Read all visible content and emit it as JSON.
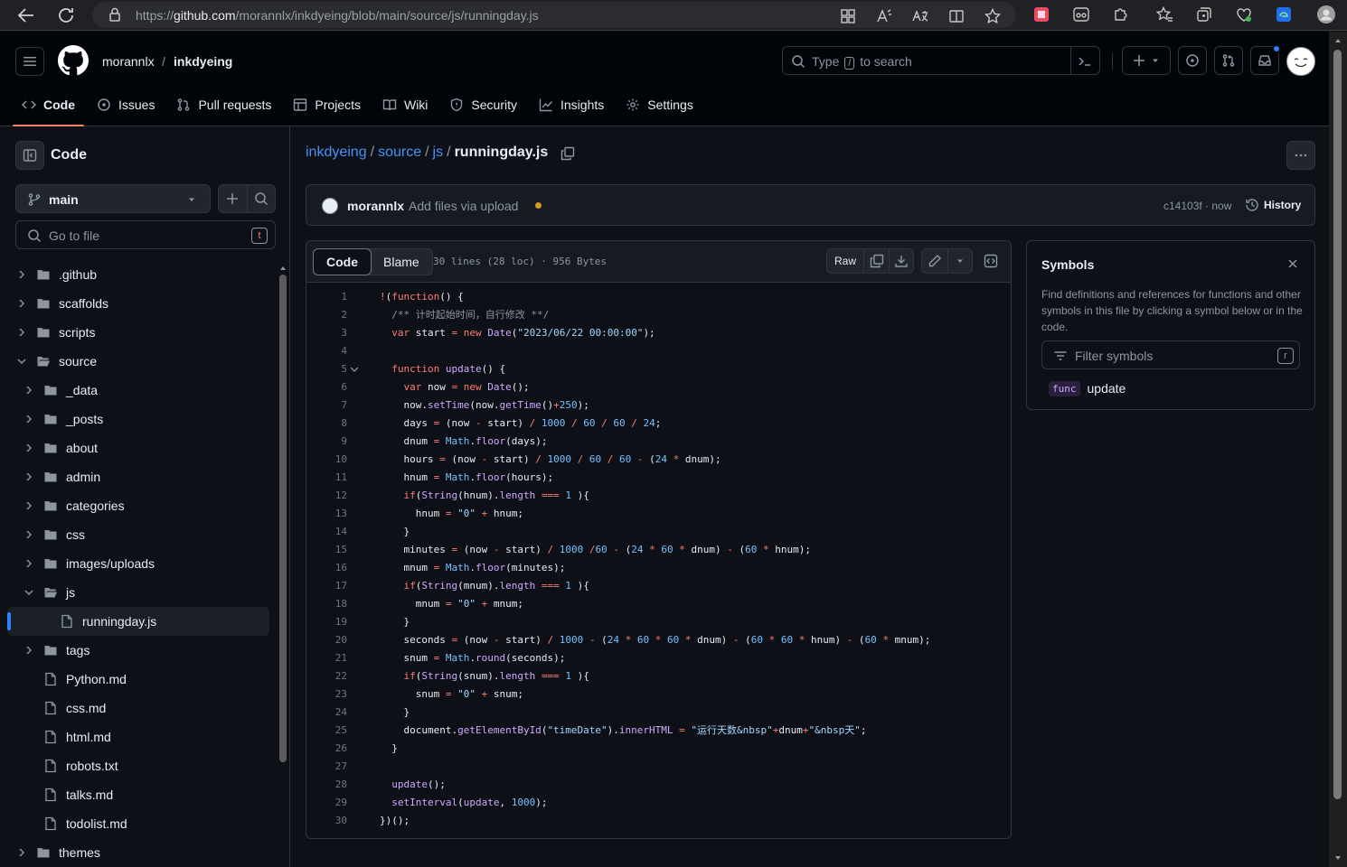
{
  "browser": {
    "url_prefix": "https://",
    "url_host": "github.com",
    "url_path": "/morannlx/inkdyeing/blob/main/source/js/runningday.js"
  },
  "header": {
    "owner": "morannlx",
    "separator": "/",
    "repo": "inkdyeing",
    "search_placeholder_before": "Type",
    "search_key": "/",
    "search_placeholder_after": "to search"
  },
  "tabs": [
    {
      "label": "Code",
      "icon": "code-icon"
    },
    {
      "label": "Issues",
      "icon": "issue-icon"
    },
    {
      "label": "Pull requests",
      "icon": "pull-request-icon"
    },
    {
      "label": "Projects",
      "icon": "table-icon"
    },
    {
      "label": "Wiki",
      "icon": "book-icon"
    },
    {
      "label": "Security",
      "icon": "shield-icon"
    },
    {
      "label": "Insights",
      "icon": "graph-icon"
    },
    {
      "label": "Settings",
      "icon": "gear-icon"
    }
  ],
  "sidebar": {
    "title": "Code",
    "branch": "main",
    "goto_placeholder": "Go to file",
    "goto_key": "t",
    "tree": [
      {
        "name": ".github",
        "type": "dir",
        "depth": 0,
        "open": false
      },
      {
        "name": "scaffolds",
        "type": "dir",
        "depth": 0,
        "open": false
      },
      {
        "name": "scripts",
        "type": "dir",
        "depth": 0,
        "open": false
      },
      {
        "name": "source",
        "type": "dir",
        "depth": 0,
        "open": true
      },
      {
        "name": "_data",
        "type": "dir",
        "depth": 1,
        "open": false
      },
      {
        "name": "_posts",
        "type": "dir",
        "depth": 1,
        "open": false
      },
      {
        "name": "about",
        "type": "dir",
        "depth": 1,
        "open": false
      },
      {
        "name": "admin",
        "type": "dir",
        "depth": 1,
        "open": false
      },
      {
        "name": "categories",
        "type": "dir",
        "depth": 1,
        "open": false
      },
      {
        "name": "css",
        "type": "dir",
        "depth": 1,
        "open": false
      },
      {
        "name": "images/uploads",
        "type": "dir",
        "depth": 1,
        "open": false
      },
      {
        "name": "js",
        "type": "dir",
        "depth": 1,
        "open": true
      },
      {
        "name": "runningday.js",
        "type": "file",
        "depth": 2,
        "selected": true
      },
      {
        "name": "tags",
        "type": "dir",
        "depth": 1,
        "open": false
      },
      {
        "name": "Python.md",
        "type": "file",
        "depth": 1
      },
      {
        "name": "css.md",
        "type": "file",
        "depth": 1
      },
      {
        "name": "html.md",
        "type": "file",
        "depth": 1
      },
      {
        "name": "robots.txt",
        "type": "file",
        "depth": 1
      },
      {
        "name": "talks.md",
        "type": "file",
        "depth": 1
      },
      {
        "name": "todolist.md",
        "type": "file",
        "depth": 1
      },
      {
        "name": "themes",
        "type": "dir",
        "depth": 0,
        "open": false
      }
    ]
  },
  "path": {
    "repo": "inkdyeing",
    "dir1": "source",
    "dir2": "js",
    "file": "runningday.js",
    "sep": "/"
  },
  "commit": {
    "user": "morannlx",
    "message": "Add files via upload",
    "sha_time": "c14103f · now",
    "history_label": "History"
  },
  "file_view": {
    "tab_code": "Code",
    "tab_blame": "Blame",
    "info": "30 lines (28 loc) · 956 Bytes",
    "raw_label": "Raw"
  },
  "code_lines": [
    "!(function() {",
    "  /** 计时起始时间，自行修改 **/",
    "  var start = new Date(\"2023/06/22 00:00:00\");",
    "",
    "  function update() {",
    "    var now = new Date();",
    "    now.setTime(now.getTime()+250);",
    "    days = (now - start) / 1000 / 60 / 60 / 24;",
    "    dnum = Math.floor(days);",
    "    hours = (now - start) / 1000 / 60 / 60 - (24 * dnum);",
    "    hnum = Math.floor(hours);",
    "    if(String(hnum).length === 1 ){",
    "      hnum = \"0\" + hnum;",
    "    }",
    "    minutes = (now - start) / 1000 /60 - (24 * 60 * dnum) - (60 * hnum);",
    "    mnum = Math.floor(minutes);",
    "    if(String(mnum).length === 1 ){",
    "      mnum = \"0\" + mnum;",
    "    }",
    "    seconds = (now - start) / 1000 - (24 * 60 * 60 * dnum) - (60 * 60 * hnum) - (60 * mnum);",
    "    snum = Math.round(seconds);",
    "    if(String(snum).length === 1 ){",
    "      snum = \"0\" + snum;",
    "    }",
    "    document.getElementById(\"timeDate\").innerHTML = \"运行天数&nbsp\"+dnum+\"&nbsp天\";",
    "  }",
    "",
    "  update();",
    "  setInterval(update, 1000);",
    "})();"
  ],
  "symbols": {
    "title": "Symbols",
    "description": "Find definitions and references for functions and other symbols in this file by clicking a symbol below or in the code.",
    "filter_placeholder": "Filter symbols",
    "filter_key": "r",
    "items": [
      {
        "kind": "func",
        "name": "update"
      }
    ]
  },
  "colors": {
    "accent_blue": "#4493f8",
    "tab_underline": "#f78166",
    "commit_dot": "#d29922"
  }
}
